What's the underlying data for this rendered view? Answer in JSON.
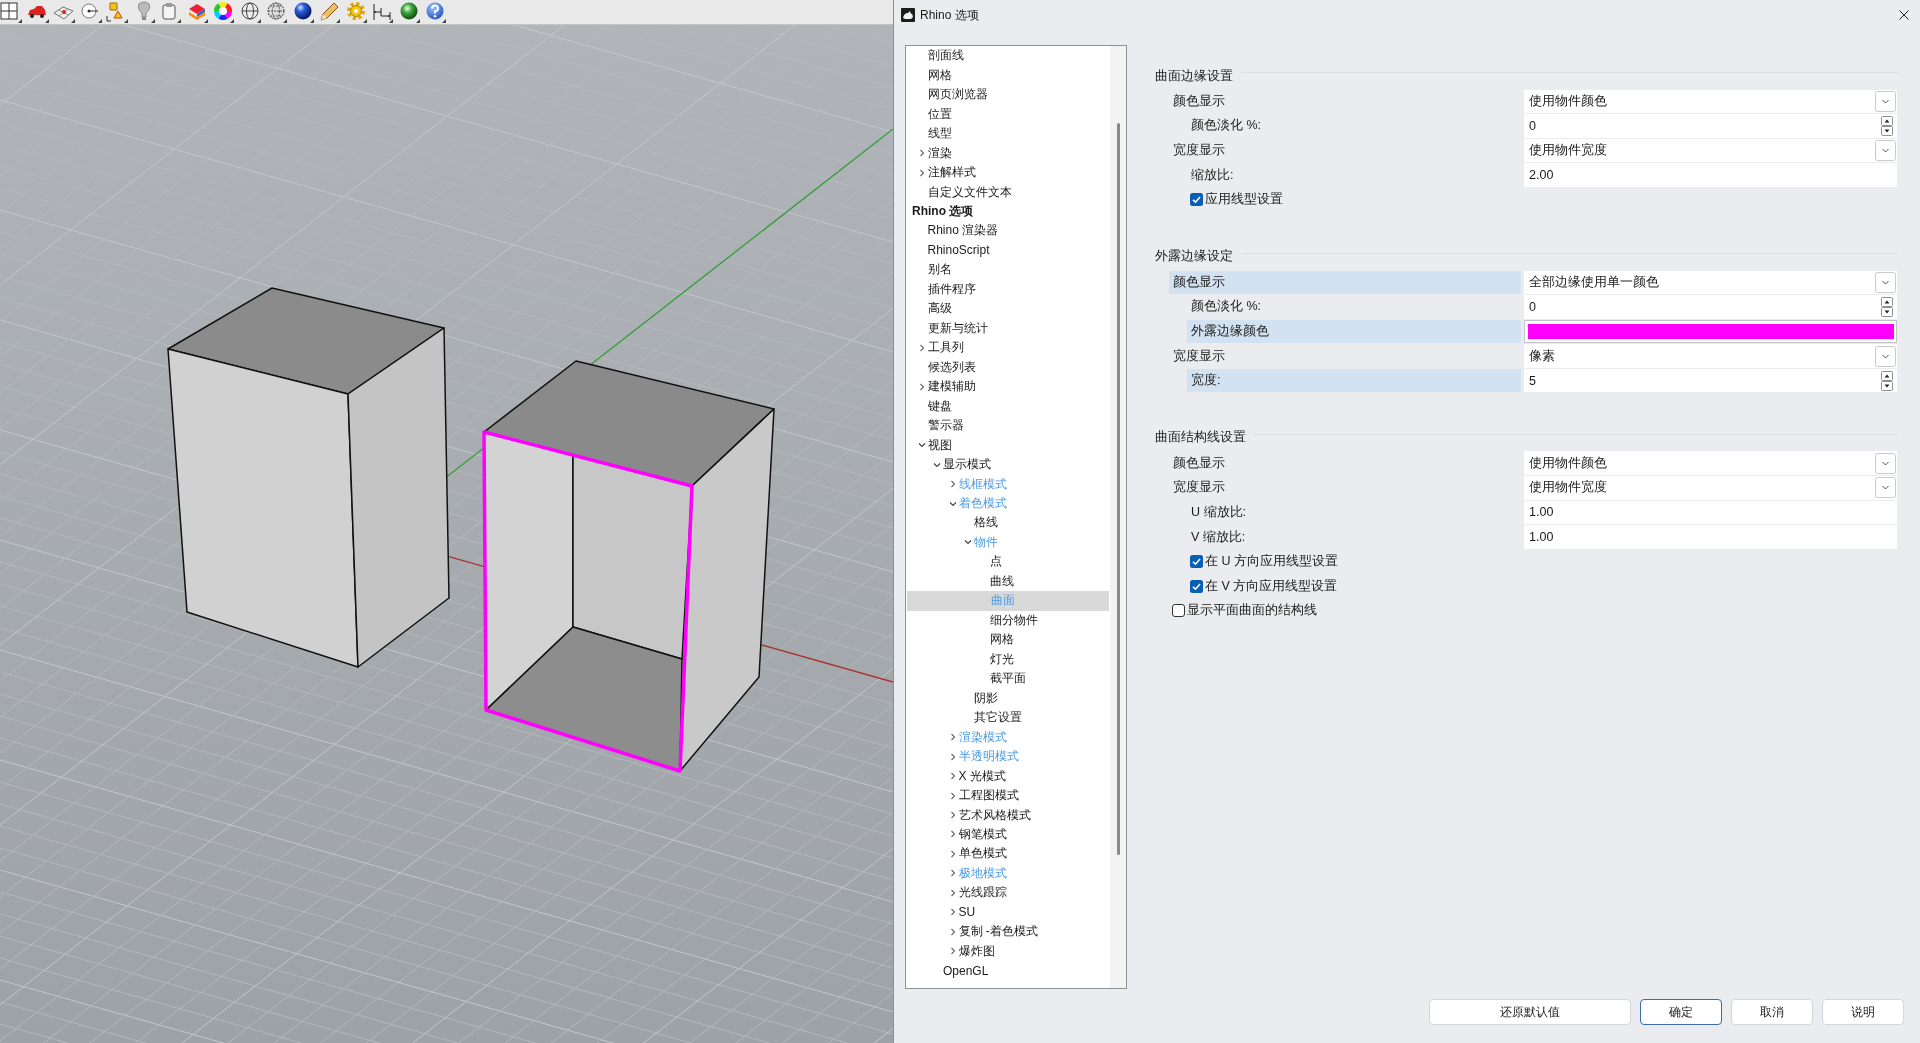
{
  "window": {
    "title": "Rhino 选项"
  },
  "tree": {
    "items": [
      {
        "children": [
          {
            "label": "剖面线",
            "selected": false,
            "accent": false
          },
          {
            "label": "网格",
            "selected": false,
            "accent": false
          },
          {
            "label": "网页浏览器",
            "selected": false,
            "accent": false
          },
          {
            "label": "位置",
            "selected": false,
            "accent": false
          },
          {
            "label": "线型",
            "selected": false,
            "accent": false
          },
          {
            "label": "渲染",
            "selected": false,
            "accent": false,
            "expanded": false
          },
          {
            "label": "注解样式",
            "selected": false,
            "accent": false,
            "expanded": false
          },
          {
            "label": "自定义文件文本",
            "selected": false,
            "accent": false
          }
        ]
      },
      {
        "label": "Rhino 选项",
        "selected": false,
        "accent": false,
        "children": [
          {
            "label": "Rhino 渲染器",
            "selected": false,
            "accent": false
          },
          {
            "label": "RhinoScript",
            "selected": false,
            "accent": false
          },
          {
            "label": "别名",
            "selected": false,
            "accent": false
          },
          {
            "label": "插件程序",
            "selected": false,
            "accent": false
          },
          {
            "label": "高级",
            "selected": false,
            "accent": false
          },
          {
            "label": "更新与统计",
            "selected": false,
            "accent": false
          },
          {
            "label": "工具列",
            "selected": false,
            "accent": false,
            "expanded": false
          },
          {
            "label": "候选列表",
            "selected": false,
            "accent": false
          },
          {
            "label": "建模辅助",
            "selected": false,
            "accent": false,
            "expanded": false
          },
          {
            "label": "键盘",
            "selected": false,
            "accent": false
          },
          {
            "label": "警示器",
            "selected": false,
            "accent": false
          },
          {
            "label": "视图",
            "selected": false,
            "accent": false,
            "expanded": true,
            "children": [
              {
                "label": "显示模式",
                "selected": false,
                "accent": false,
                "expanded": true,
                "children": [
                  {
                    "label": "线框模式",
                    "selected": false,
                    "accent": true,
                    "expanded": false
                  },
                  {
                    "label": "着色模式",
                    "selected": false,
                    "accent": true,
                    "expanded": true,
                    "children": [
                      {
                        "label": "格线",
                        "selected": false,
                        "accent": false
                      },
                      {
                        "label": "物件",
                        "selected": false,
                        "accent": true,
                        "expanded": true,
                        "children": [
                          {
                            "label": "点",
                            "selected": false,
                            "accent": false
                          },
                          {
                            "label": "曲线",
                            "selected": false,
                            "accent": false
                          },
                          {
                            "label": "曲面",
                            "selected": true,
                            "accent": true
                          },
                          {
                            "label": "细分物件",
                            "selected": false,
                            "accent": false
                          },
                          {
                            "label": "网格",
                            "selected": false,
                            "accent": false
                          },
                          {
                            "label": "灯光",
                            "selected": false,
                            "accent": false
                          },
                          {
                            "label": "截平面",
                            "selected": false,
                            "accent": false
                          }
                        ]
                      },
                      {
                        "label": "阴影",
                        "selected": false,
                        "accent": false
                      },
                      {
                        "label": "其它设置",
                        "selected": false,
                        "accent": false
                      }
                    ]
                  },
                  {
                    "label": "渲染模式",
                    "selected": false,
                    "accent": true,
                    "expanded": false
                  },
                  {
                    "label": "半透明模式",
                    "selected": false,
                    "accent": true,
                    "expanded": false
                  },
                  {
                    "label": "X 光模式",
                    "selected": false,
                    "accent": false,
                    "expanded": false
                  },
                  {
                    "label": "工程图模式",
                    "selected": false,
                    "accent": false,
                    "expanded": false
                  },
                  {
                    "label": "艺术风格模式",
                    "selected": false,
                    "accent": false,
                    "expanded": false
                  },
                  {
                    "label": "钢笔模式",
                    "selected": false,
                    "accent": false,
                    "expanded": false
                  },
                  {
                    "label": "单色模式",
                    "selected": false,
                    "accent": false,
                    "expanded": false
                  },
                  {
                    "label": "极地模式",
                    "selected": false,
                    "accent": true,
                    "expanded": false
                  },
                  {
                    "label": "光线跟踪",
                    "selected": false,
                    "accent": false,
                    "expanded": false
                  },
                  {
                    "label": "SU",
                    "selected": false,
                    "accent": false,
                    "expanded": false
                  },
                  {
                    "label": "复制 -着色模式",
                    "selected": false,
                    "accent": false,
                    "expanded": false
                  },
                  {
                    "label": "爆炸图",
                    "selected": false,
                    "accent": false,
                    "expanded": false
                  }
                ]
              },
              {
                "label": "OpenGL",
                "selected": false,
                "accent": false
              }
            ]
          }
        ]
      }
    ]
  },
  "settings": {
    "sections": [
      {
        "title": "曲面边缘设置",
        "rows": [
          {
            "kind": "dropdown",
            "label": "颜色显示",
            "value": "使用物件颜色",
            "highlighted": false,
            "children": [
              {
                "kind": "spinner",
                "label": "颜色淡化 %:",
                "value": "0",
                "highlighted": false
              }
            ]
          },
          {
            "kind": "dropdown",
            "label": "宽度显示",
            "value": "使用物件宽度",
            "highlighted": false,
            "children": [
              {
                "kind": "text",
                "label": "缩放比:",
                "value": "2.00",
                "highlighted": false
              },
              {
                "kind": "checkbox",
                "label": "应用线型设置",
                "checked": true,
                "highlighted": false
              }
            ]
          }
        ]
      },
      {
        "title": "外露边缘设定",
        "rows": [
          {
            "kind": "dropdown",
            "label": "颜色显示",
            "value": "全部边缘使用单一颜色",
            "highlighted": true,
            "children": [
              {
                "kind": "spinner",
                "label": "颜色淡化 %:",
                "value": "0",
                "highlighted": false
              },
              {
                "kind": "color",
                "label": "外露边缘颜色",
                "color": "#ff00ff",
                "highlighted": true
              }
            ]
          },
          {
            "kind": "dropdown",
            "label": "宽度显示",
            "value": "像素",
            "highlighted": false,
            "children": [
              {
                "kind": "spinner",
                "label": "宽度:",
                "value": "5",
                "highlighted": true
              }
            ]
          }
        ]
      },
      {
        "title": "曲面结构线设置",
        "rows": [
          {
            "kind": "dropdown",
            "label": "颜色显示",
            "value": "使用物件颜色",
            "highlighted": false
          },
          {
            "kind": "dropdown",
            "label": "宽度显示",
            "value": "使用物件宽度",
            "highlighted": false,
            "children": [
              {
                "kind": "text",
                "label": "U 缩放比:",
                "value": "1.00",
                "highlighted": false
              },
              {
                "kind": "text",
                "label": "V 缩放比:",
                "value": "1.00",
                "highlighted": false
              },
              {
                "kind": "checkbox",
                "label": "在 U 方向应用线型设置",
                "checked": true,
                "highlighted": false
              },
              {
                "kind": "checkbox",
                "label": "在 V 方向应用线型设置",
                "checked": true,
                "highlighted": false
              }
            ]
          },
          {
            "kind": "checkbox",
            "label": "显示平面曲面的结构线",
            "checked": false,
            "highlighted": false
          }
        ]
      }
    ]
  },
  "buttons": [
    {
      "label": "还原默认值",
      "default": false
    },
    {
      "label": "确定",
      "default": true
    },
    {
      "label": "取消",
      "default": false
    },
    {
      "label": "说明",
      "default": false
    }
  ]
}
